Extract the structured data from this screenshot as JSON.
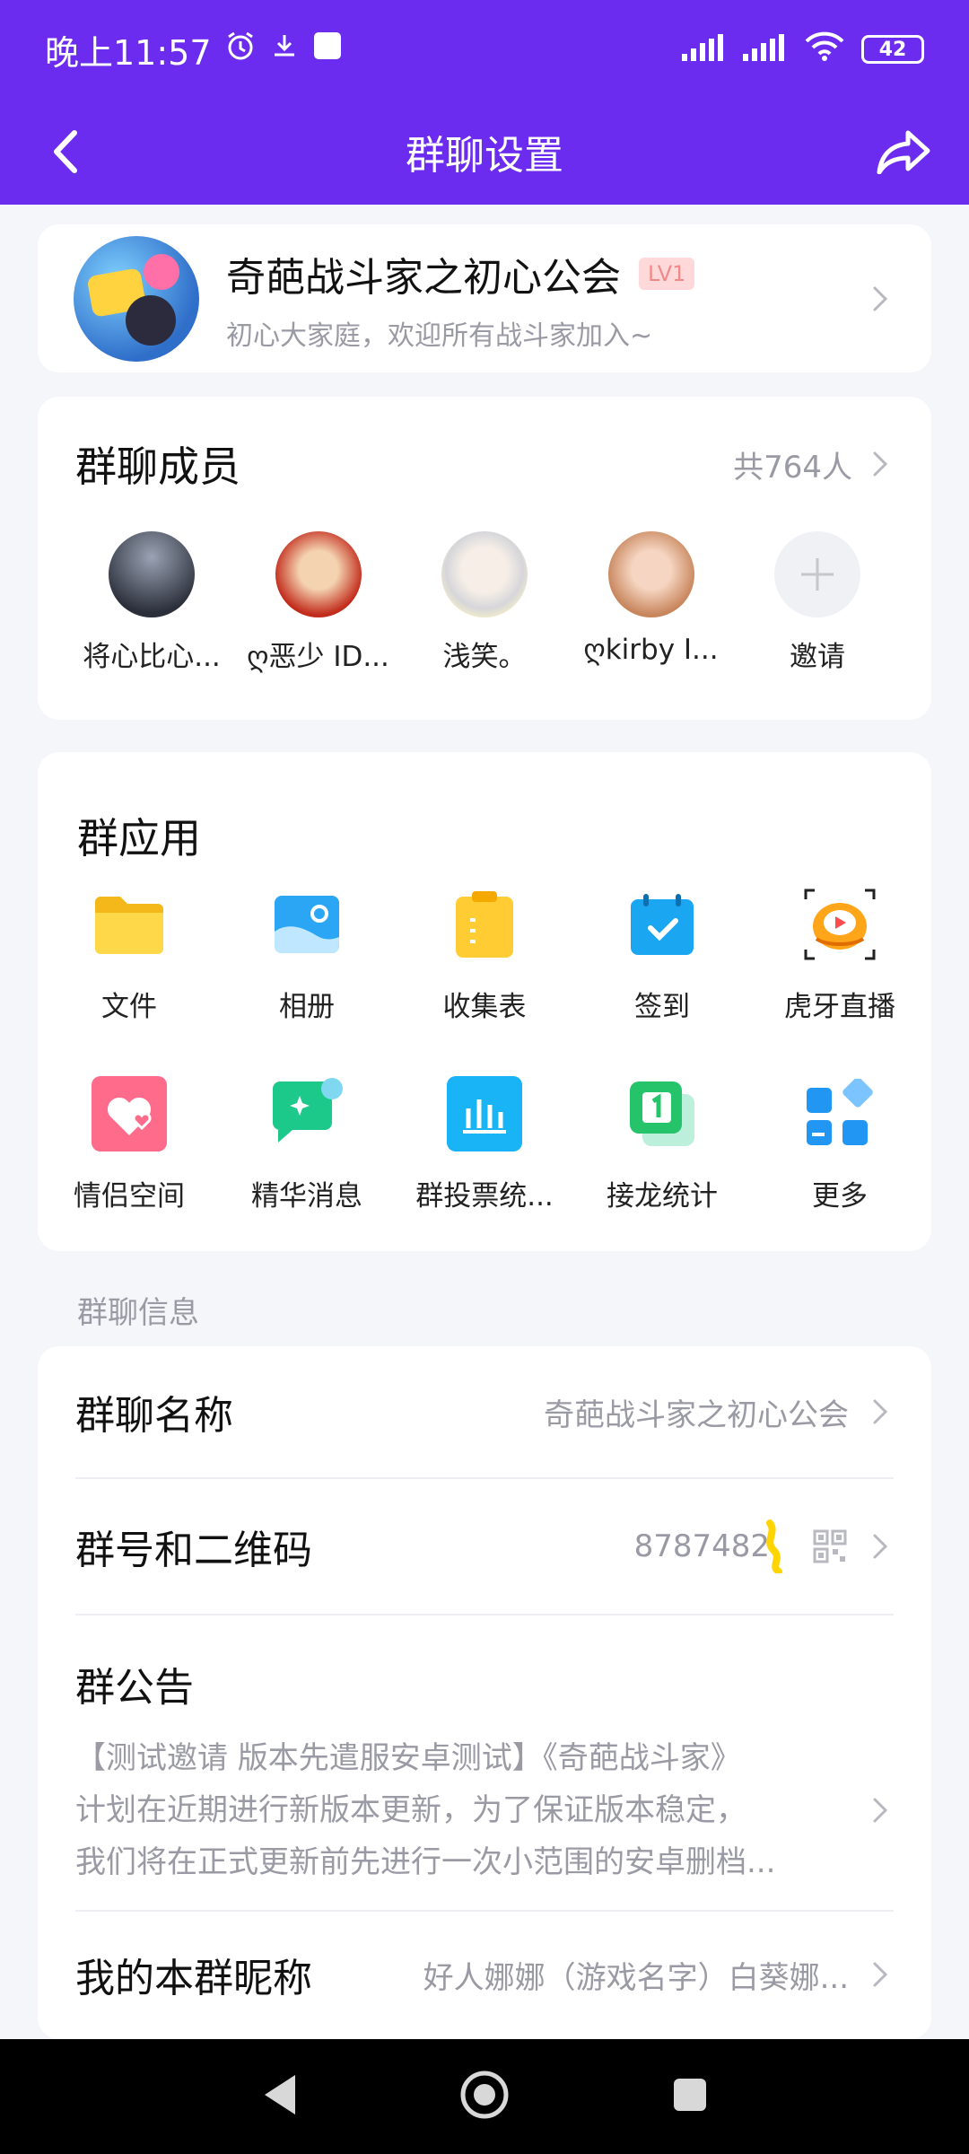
{
  "status": {
    "time": "晚上11:57",
    "battery": "42"
  },
  "header": {
    "title": "群聊设置"
  },
  "group": {
    "name": "奇葩战斗家之初心公会",
    "level": "LV1",
    "description": "初心大家庭，欢迎所有战斗家加入~"
  },
  "members": {
    "title": "群聊成员",
    "count": "共764人",
    "list": [
      {
        "name": "将心比心..."
      },
      {
        "name": "ღ恶少 ID..."
      },
      {
        "name": "浅笑。"
      },
      {
        "name": "ღkirby I..."
      }
    ],
    "invite_label": "邀请"
  },
  "apps": {
    "title": "群应用",
    "items": [
      {
        "label": "文件",
        "icon": "folder-icon",
        "color": "#ffcc33"
      },
      {
        "label": "相册",
        "icon": "album-icon",
        "color": "#2aa6f5"
      },
      {
        "label": "收集表",
        "icon": "form-icon",
        "color": "#ffcc33"
      },
      {
        "label": "签到",
        "icon": "checkin-icon",
        "color": "#1aa6f0"
      },
      {
        "label": "虎牙直播",
        "icon": "huya-icon",
        "color": "#ffa51a"
      },
      {
        "label": "情侣空间",
        "icon": "heart-icon",
        "color": "#ff6b8a"
      },
      {
        "label": "精华消息",
        "icon": "essence-icon",
        "color": "#1dc9a0"
      },
      {
        "label": "群投票统...",
        "icon": "vote-icon",
        "color": "#18b4f5"
      },
      {
        "label": "接龙统计",
        "icon": "relay-icon",
        "color": "#25c46a"
      },
      {
        "label": "更多",
        "icon": "more-apps-icon",
        "color": "#2196f3"
      }
    ]
  },
  "info": {
    "section_label": "群聊信息",
    "name_row": {
      "title": "群聊名称",
      "value": "奇葩战斗家之初心公会"
    },
    "number_row": {
      "title": "群号和二维码",
      "value": "8787482"
    },
    "announcement": {
      "title": "群公告",
      "line1": "【测试邀请 版本先遣服安卓测试】《奇葩战斗家》",
      "line2": "计划在近期进行新版本更新，为了保证版本稳定，",
      "line3": "我们将在正式更新前先进行一次小范围的安卓删档..."
    },
    "nickname_row": {
      "title": "我的本群昵称",
      "value": "好人娜娜（游戏名字）白葵娜..."
    }
  },
  "colors": {
    "accent": "#6c2cf0",
    "background": "#f5f6fa",
    "secondary_text": "#9a9aa4"
  }
}
